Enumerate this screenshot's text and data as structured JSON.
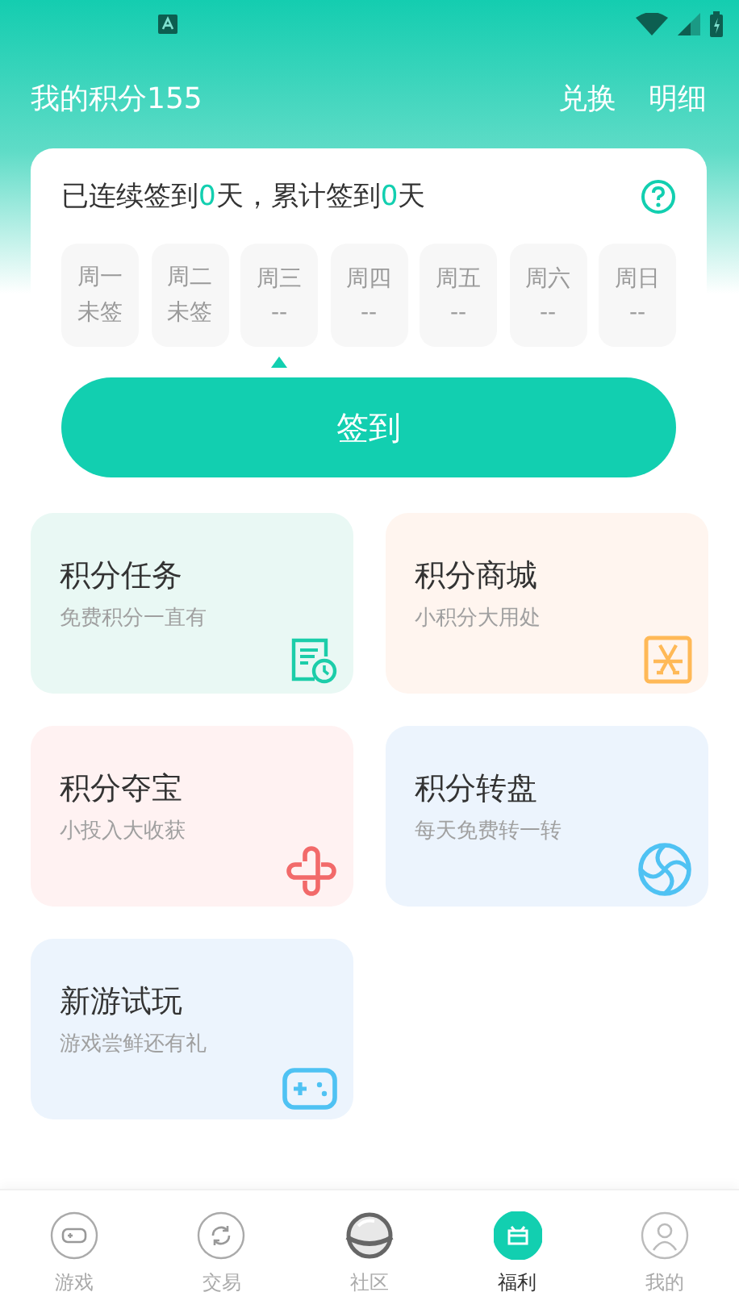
{
  "header": {
    "points": "我的积分155",
    "actions": [
      "兑换",
      "明细"
    ]
  },
  "checkin": {
    "summary": "已连续签到**0**天，累计签到**0**天",
    "days": [
      {
        "day": "周一",
        "status": "未签",
        "selected": false
      },
      {
        "day": "周二",
        "status": "未签",
        "selected": false
      },
      {
        "day": "周三",
        "status": "--",
        "selected": true
      },
      {
        "day": "周四",
        "status": "--",
        "selected": false
      },
      {
        "day": "周五",
        "status": "--",
        "selected": false
      },
      {
        "day": "周六",
        "status": "--",
        "selected": false
      },
      {
        "day": "周日",
        "status": "--",
        "selected": false
      }
    ],
    "button": "签到"
  },
  "cards": [
    {
      "title": "积分任务",
      "subtitle": "免费积分一直有",
      "kind": "task",
      "color": "#e9f8f4"
    },
    {
      "title": "积分商城",
      "subtitle": "小积分大用处",
      "kind": "mall",
      "color": "#fff5ef"
    },
    {
      "title": "积分夺宝",
      "subtitle": "小投入大收获",
      "kind": "treasure",
      "color": "#fff2f2"
    },
    {
      "title": "积分转盘",
      "subtitle": "每天免费转一转",
      "kind": "wheel",
      "color": "#ecf4fd"
    },
    {
      "title": "新游试玩",
      "subtitle": "游戏尝鲜还有礼",
      "kind": "game",
      "color": "#ecf4fd"
    }
  ],
  "tabs": [
    {
      "label": "游戏",
      "kind": "game",
      "selected": false
    },
    {
      "label": "交易",
      "kind": "trade",
      "selected": false
    },
    {
      "label": "社区",
      "kind": "planet",
      "selected": false
    },
    {
      "label": "福利",
      "kind": "gift",
      "selected": true
    },
    {
      "label": "我的",
      "kind": "user",
      "selected": false
    }
  ]
}
